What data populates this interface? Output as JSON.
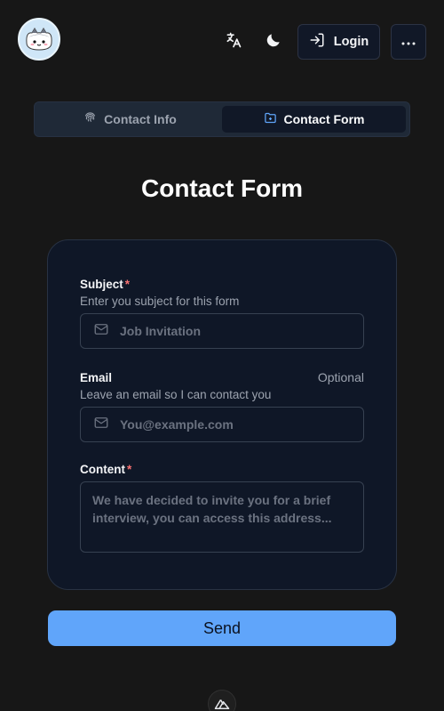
{
  "header": {
    "avatar_alt": "cat avatar",
    "translate_icon": "translate-icon",
    "theme_icon": "moon-icon",
    "login_label": "Login",
    "login_icon": "login-icon",
    "more_icon": "ellipsis-icon"
  },
  "tabs": [
    {
      "label": "Contact Info",
      "icon": "fingerprint-icon",
      "active": false
    },
    {
      "label": "Contact Form",
      "icon": "folder-icon",
      "active": true
    }
  ],
  "page_title": "Contact Form",
  "form": {
    "subject": {
      "label": "Subject",
      "required_mark": "*",
      "hint": "Enter you subject for this form",
      "placeholder": "Job Invitation",
      "icon": "mail-icon"
    },
    "email": {
      "label": "Email",
      "optional": "Optional",
      "hint": "Leave an email so I can contact you",
      "placeholder": "You@example.com",
      "icon": "mail-icon"
    },
    "content": {
      "label": "Content",
      "required_mark": "*",
      "placeholder": "We have decided to invite you for a brief interview, you can access this address..."
    }
  },
  "send_label": "Send",
  "footer_icon": "nuxt-logo-icon",
  "colors": {
    "background": "#171717",
    "card": "#0f1727",
    "accent": "#60a5fa",
    "required": "#f87171"
  }
}
